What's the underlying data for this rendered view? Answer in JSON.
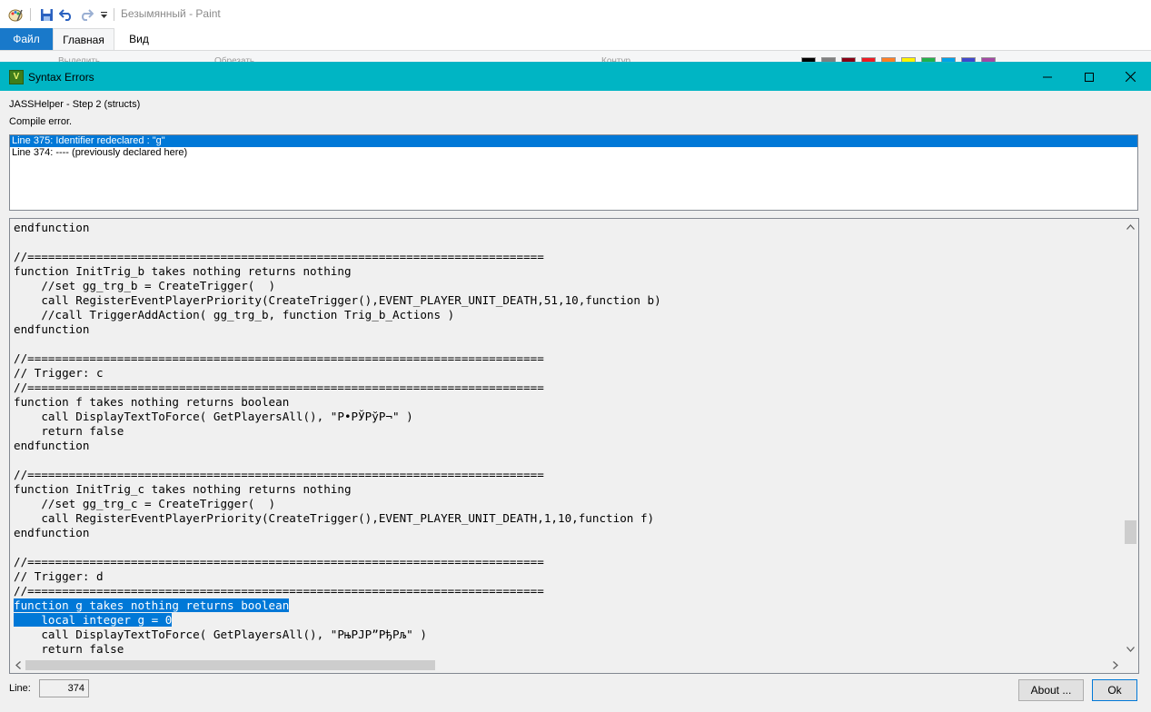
{
  "paint": {
    "title": "Безымянный - Paint",
    "tabs": [
      "Файл",
      "Главная",
      "Вид"
    ],
    "ribbon_ghost": [
      "Выделить",
      "Обрезать",
      "Контур"
    ],
    "palette": [
      "#000000",
      "#7f7f7f",
      "#880015",
      "#ed1c24",
      "#ff7f27",
      "#fff200",
      "#22b14c",
      "#00a2e8",
      "#3f48cc",
      "#a349a4"
    ],
    "icons": [
      "paint-app-icon",
      "save-icon",
      "undo-icon",
      "redo-icon",
      "customize-qat-icon"
    ]
  },
  "dialog": {
    "title": "Syntax Errors",
    "step_label": "JASSHelper - Step 2 (structs)",
    "compile_label": "Compile error.",
    "errors": [
      {
        "text": "Line 375: Identifier redeclared : \"g\"",
        "selected": true
      },
      {
        "text": "Line 374: ---- (previously declared here)",
        "selected": false
      }
    ],
    "code_lines": [
      "endfunction",
      "",
      "//===========================================================================",
      "function InitTrig_b takes nothing returns nothing",
      "    //set gg_trg_b = CreateTrigger(  )",
      "    call RegisterEventPlayerPriority(CreateTrigger(),EVENT_PLAYER_UNIT_DEATH,51,10,function b)",
      "    //call TriggerAddAction( gg_trg_b, function Trig_b_Actions )",
      "endfunction",
      "",
      "//===========================================================================",
      "// Trigger: c",
      "//===========================================================================",
      "function f takes nothing returns boolean",
      "    call DisplayTextToForce( GetPlayersAll(), \"Р•РЎРўР¬\" )",
      "    return false",
      "endfunction",
      "",
      "//===========================================================================",
      "function InitTrig_c takes nothing returns nothing",
      "    //set gg_trg_c = CreateTrigger(  )",
      "    call RegisterEventPlayerPriority(CreateTrigger(),EVENT_PLAYER_UNIT_DEATH,1,10,function f)",
      "endfunction",
      "",
      "//===========================================================================",
      "// Trigger: d",
      "//===========================================================================",
      "function g takes nothing returns boolean",
      "    local integer g = 0",
      "    call DisplayTextToForce( GetPlayersAll(), \"РњРЈР”РђРљ\" )",
      "    return false"
    ],
    "highlighted_lines": [
      26,
      27
    ],
    "line_label": "Line:",
    "line_value": "374",
    "about_button": "About ...",
    "ok_button": "Ok"
  }
}
